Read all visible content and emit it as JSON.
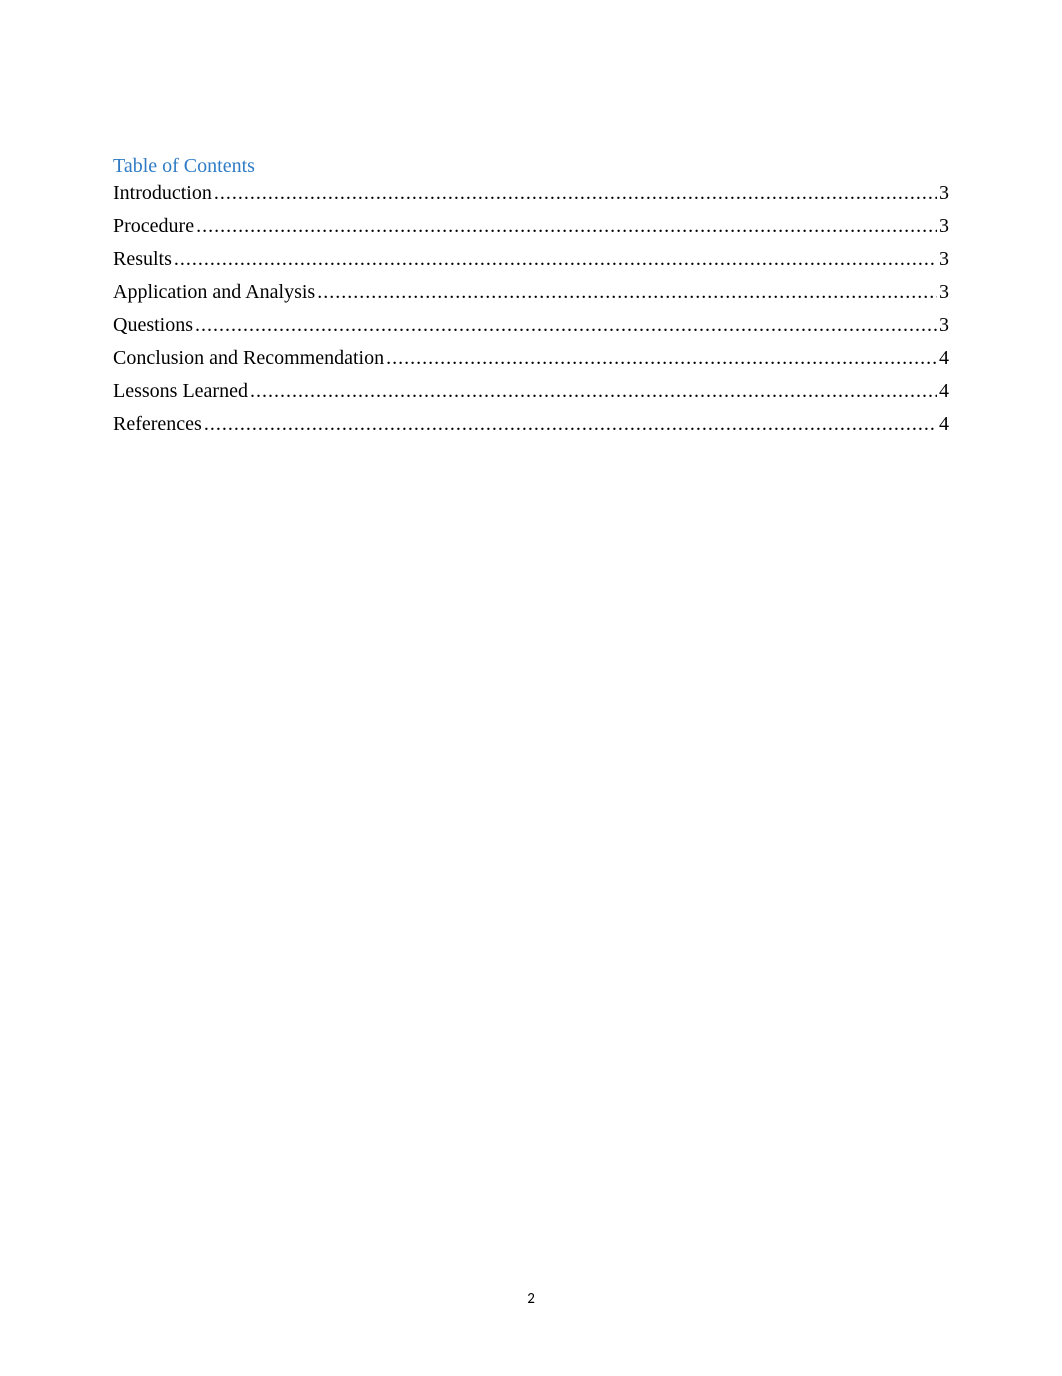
{
  "toc": {
    "heading": "Table of Contents",
    "entries": [
      {
        "title": "Introduction",
        "page": "3"
      },
      {
        "title": "Procedure",
        "page": "3"
      },
      {
        "title": "Results",
        "page": "3"
      },
      {
        "title": "Application and Analysis",
        "page": "3"
      },
      {
        "title": "Questions",
        "page": "3"
      },
      {
        "title": "Conclusion and Recommendation",
        "page": "4"
      },
      {
        "title": "Lessons Learned",
        "page": "4"
      },
      {
        "title": "References",
        "page": "4"
      }
    ]
  },
  "page_number": "2"
}
